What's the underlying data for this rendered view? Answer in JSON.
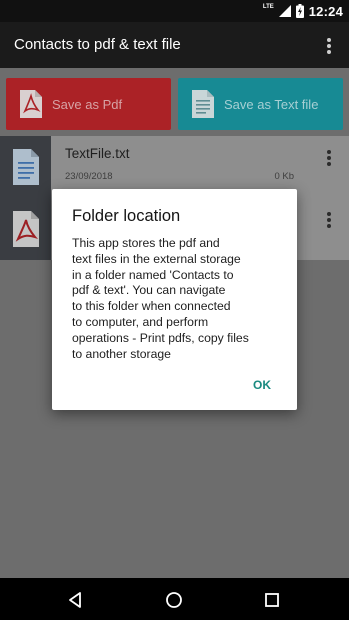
{
  "status_bar": {
    "network": "LTE",
    "time": "12:24"
  },
  "app_bar": {
    "title": "Contacts to pdf & text file",
    "overflow_icon": "more-vert-icon"
  },
  "actions": {
    "pdf": {
      "label": "Save as Pdf",
      "color": "#ab2226",
      "icon": "pdf-file-icon"
    },
    "text": {
      "label": "Save as Text file",
      "color": "#178a94",
      "icon": "text-file-icon"
    }
  },
  "files": [
    {
      "name": "TextFile.txt",
      "date": "23/09/2018",
      "size": "0 Kb",
      "icon": "text-file-icon"
    },
    {
      "name": "",
      "date": "",
      "size": "",
      "icon": "pdf-file-icon"
    }
  ],
  "dialog": {
    "title": "Folder location",
    "message": "This app stores the pdf and\ntext files in the external storage\nin a folder named 'Contacts to\npdf & text'. You can navigate\nto this folder when connected\nto computer, and perform\noperations - Print pdfs, copy files\nto another storage",
    "ok_label": "OK"
  },
  "nav_bar": {
    "icons": [
      "back-icon",
      "home-icon",
      "recents-icon"
    ]
  }
}
